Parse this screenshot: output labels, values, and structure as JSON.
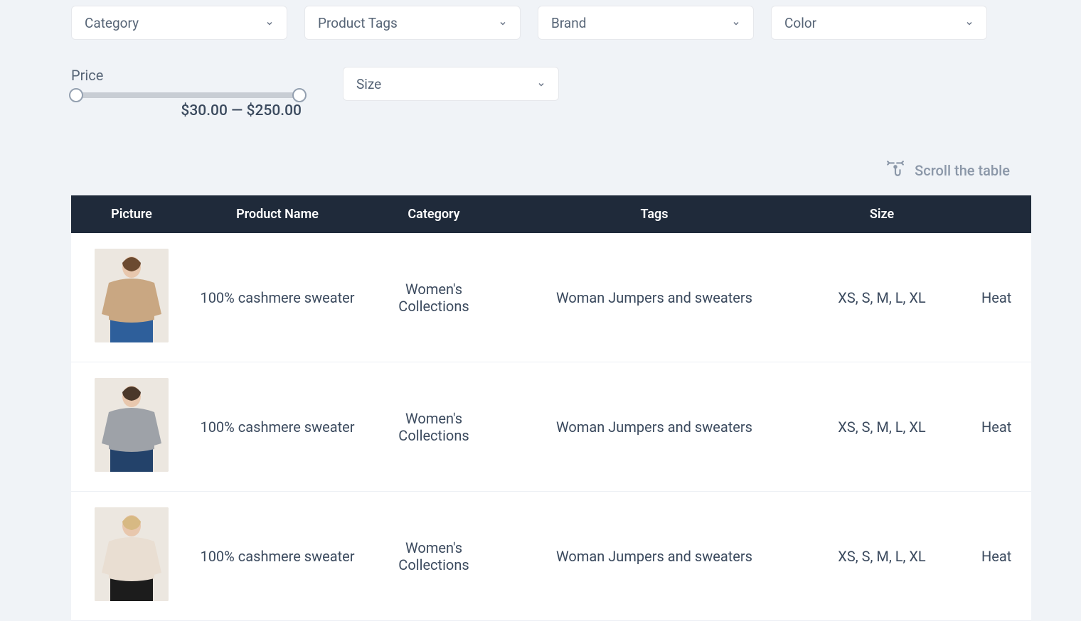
{
  "filters": {
    "category": {
      "label": "Category"
    },
    "product_tags": {
      "label": "Product Tags"
    },
    "brand": {
      "label": "Brand"
    },
    "color": {
      "label": "Color"
    },
    "size": {
      "label": "Size"
    },
    "price": {
      "label": "Price",
      "min": 30.0,
      "max": 250.0,
      "range_text": "$30.00 — $250.00"
    }
  },
  "scroll_hint": "Scroll the table",
  "table": {
    "headers": {
      "picture": "Picture",
      "product_name": "Product Name",
      "category": "Category",
      "tags": "Tags",
      "size": "Size"
    },
    "rows": [
      {
        "picture_alt": "Woman in beige cashmere sweater",
        "sweater_color": "#c9a782",
        "pants_color": "#2e5f9b",
        "hair_color": "#6b4a30",
        "product_name": "100% cashmere sweater",
        "category": "Women's Collections",
        "tags": "Woman Jumpers and sweaters",
        "size": "XS, S, M, L, XL",
        "extra": "Heat"
      },
      {
        "picture_alt": "Woman in grey cashmere sweater",
        "sweater_color": "#9ea2a8",
        "pants_color": "#23426a",
        "hair_color": "#4a382a",
        "product_name": "100% cashmere sweater",
        "category": "Women's Collections",
        "tags": "Woman Jumpers and sweaters",
        "size": "XS, S, M, L, XL",
        "extra": "Heat"
      },
      {
        "picture_alt": "Woman in cream cashmere sweater",
        "sweater_color": "#e9ded2",
        "pants_color": "#1c1c1c",
        "hair_color": "#d7b983",
        "product_name": "100% cashmere sweater",
        "category": "Women's Collections",
        "tags": "Woman Jumpers and sweaters",
        "size": "XS, S, M, L, XL",
        "extra": "Heat"
      }
    ]
  }
}
